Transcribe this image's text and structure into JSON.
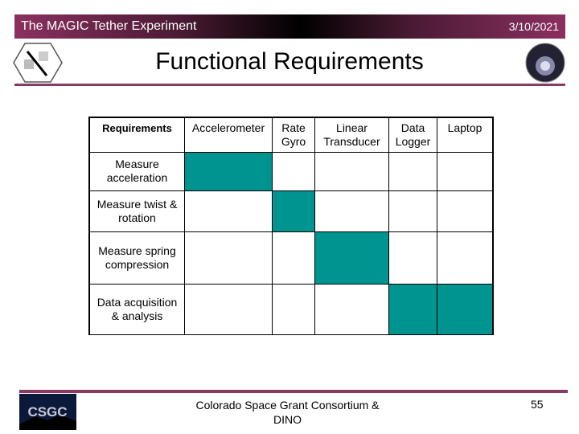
{
  "header": {
    "title": "The MAGIC Tether Experiment",
    "date": "3/10/2021"
  },
  "slide": {
    "title": "Functional Requirements"
  },
  "table": {
    "headers": [
      "Requirements",
      "Accelerometer",
      "Rate Gyro",
      "Linear Transducer",
      "Data Logger",
      "Laptop"
    ],
    "rows": [
      {
        "label": "Measure acceleration",
        "filled": [
          1
        ]
      },
      {
        "label": "Measure twist & rotation",
        "filled": [
          2
        ]
      },
      {
        "label": "Measure spring compression",
        "filled": [
          3
        ]
      },
      {
        "label": "Data acquisition & analysis",
        "filled": [
          4,
          5
        ]
      }
    ],
    "fill_color": "#009490"
  },
  "footer": {
    "text": "Colorado Space Grant Consortium  & DINO",
    "page": "55",
    "logo_text": "CSGC"
  },
  "colors": {
    "accent": "#8b3a62"
  }
}
